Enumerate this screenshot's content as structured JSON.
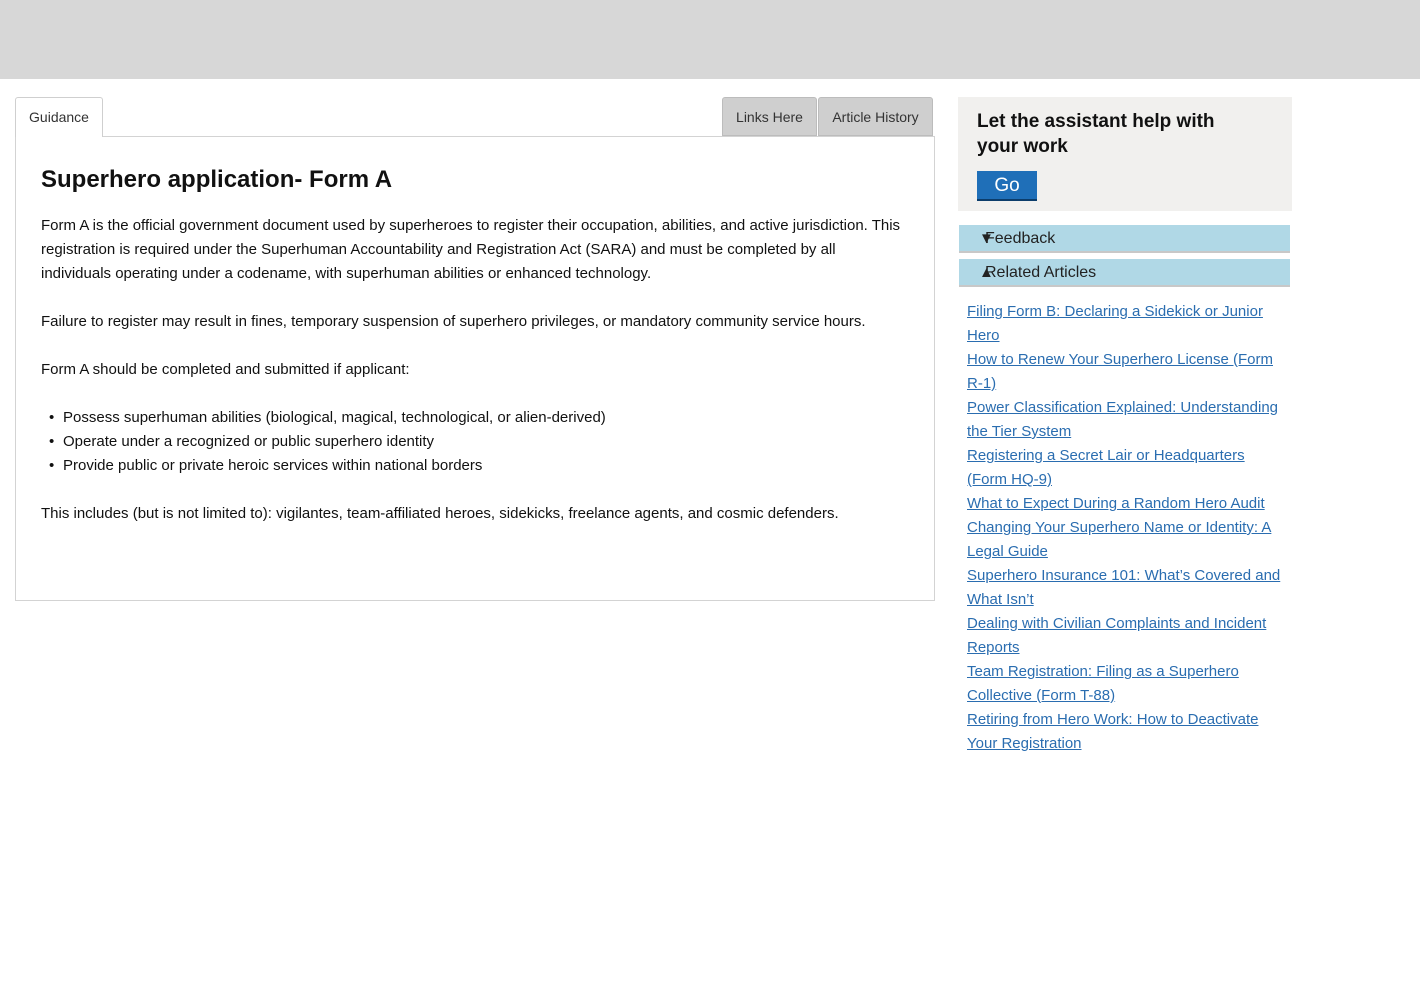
{
  "tabs": {
    "guidance": "Guidance",
    "links_here": "Links Here",
    "article_history": "Article History"
  },
  "article": {
    "title": "Superhero application- Form A",
    "paragraphs": [
      "Form A is the official government document used by superheroes to register their occupation, abilities, and active jurisdiction. This registration is required under the Superhuman Accountability and Registration Act (SARA) and must be completed by all individuals operating under a codename, with superhuman abilities or enhanced technology.",
      "Failure to register may result in fines, temporary suspension of superhero privileges, or mandatory community service hours.",
      "Form A should be completed and submitted if applicant:"
    ],
    "bullets": [
      "Possess superhuman abilities (biological, magical, technological, or alien-derived)",
      "Operate under a recognized or public superhero identity",
      "Provide public or private heroic services within national borders"
    ],
    "closing": "This includes (but is not limited to): vigilantes, team-affiliated heroes, sidekicks, freelance agents, and cosmic defenders."
  },
  "sidebar": {
    "assistant_prompt": "Let the assistant help with your work",
    "go_label": "Go",
    "feedback": {
      "label": "Feedback",
      "icon": "triangle-down-icon",
      "glyph": "▼"
    },
    "related": {
      "label": "Related Articles",
      "icon": "triangle-up-icon",
      "glyph": "▲"
    },
    "related_articles": [
      "Filing Form B: Declaring a Sidekick or Junior Hero",
      "How to Renew Your Superhero License (Form R-1)",
      "Power Classification Explained: Understanding the Tier System",
      "Registering a Secret Lair or Headquarters (Form HQ-9)",
      "What to Expect During a Random Hero Audit",
      "Changing Your Superhero Name or Identity: A Legal Guide",
      "Superhero Insurance 101: What’s Covered and What Isn’t",
      "Dealing with Civilian Complaints and Incident Reports",
      "Team Registration: Filing as a Superhero Collective (Form T-88)",
      "Retiring from Hero Work: How to Deactivate Your Registration"
    ]
  },
  "colors": {
    "banner": "#d7d7d7",
    "accordion": "#b0d8e6",
    "link": "#2a6db0",
    "go_button": "#1f6fb8"
  }
}
